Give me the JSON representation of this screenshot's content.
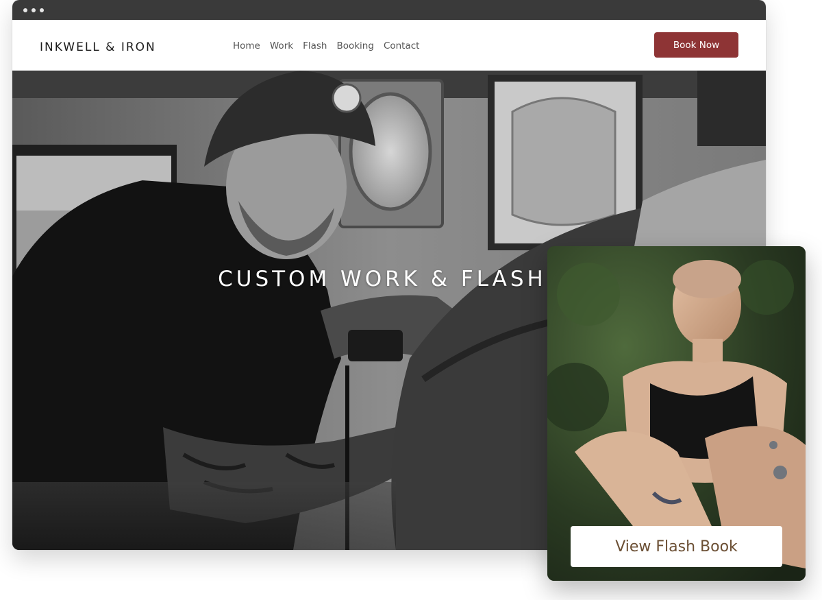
{
  "site": {
    "logo": "INKWELL & IRON",
    "nav": [
      {
        "label": "Home"
      },
      {
        "label": "Work"
      },
      {
        "label": "Flash"
      },
      {
        "label": "Booking"
      },
      {
        "label": "Contact"
      }
    ],
    "cta_label": "Book Now"
  },
  "hero": {
    "title": "CUSTOM WORK & FLASH"
  },
  "card": {
    "button_label": "View Flash Book"
  },
  "colors": {
    "accent": "#8e3435",
    "card_button_text": "#6b4f34",
    "titlebar": "#3a3a3a"
  }
}
